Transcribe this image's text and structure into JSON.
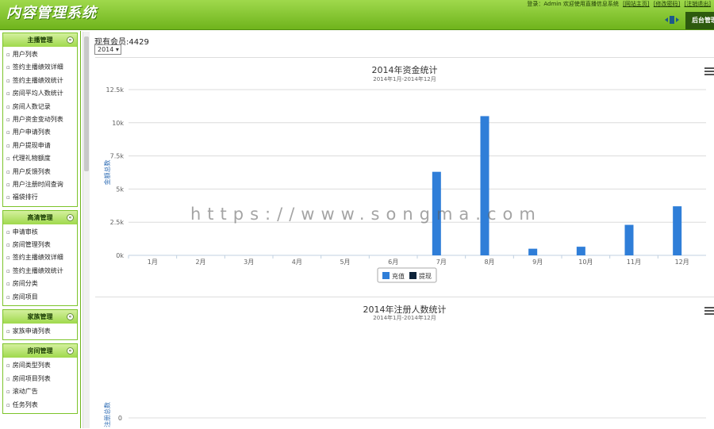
{
  "header": {
    "app_title": "内容管理系统",
    "login_text": "登录：Admin  欢迎使用直播信息系统",
    "links": [
      "[网站主页]",
      "[修改密码]",
      "[注销退出]"
    ],
    "backend_tab": "后台管理"
  },
  "sidebar": {
    "groups": [
      {
        "title": "主播管理",
        "items": [
          "用户列表",
          "签约主播绩效详细",
          "签约主播绩效统计",
          "房间平均人数统计",
          "房间人数记录",
          "用户资金变动列表",
          "用户申请列表",
          "用户提现申请",
          "代理礼物额度",
          "用户反馈列表",
          "用户注册时间查询",
          "福袋排行"
        ]
      },
      {
        "title": "高清管理",
        "items": [
          "申请审核",
          "房间管理列表",
          "签约主播绩效详细",
          "签约主播绩效统计",
          "房间分类",
          "房间项目"
        ]
      },
      {
        "title": "家族管理",
        "items": [
          "家族申请列表"
        ]
      },
      {
        "title": "房间管理",
        "items": [
          "房间类型列表",
          "房间项目列表",
          "滚动广告",
          "任务列表"
        ]
      }
    ]
  },
  "main": {
    "member_label": "现有会员:",
    "member_count": "4429",
    "year_select": "2014"
  },
  "watermark": "https://www.songma.com",
  "colors": {
    "header": "#8fcf3c",
    "bar_recharge": "#2f7ed8",
    "bar_withdraw": "#0d233a"
  },
  "chart_data": [
    {
      "type": "bar",
      "title": "2014年资金统计",
      "subtitle": "2014年1月-2014年12月",
      "ylabel": "金额总数",
      "categories": [
        "1月",
        "2月",
        "3月",
        "4月",
        "5月",
        "6月",
        "7月",
        "8月",
        "9月",
        "10月",
        "11月",
        "12月"
      ],
      "series": [
        {
          "name": "充值",
          "color": "#2f7ed8",
          "values": [
            0,
            0,
            0,
            0,
            0,
            0,
            6300,
            10500,
            500,
            650,
            2300,
            3700
          ]
        },
        {
          "name": "提现",
          "color": "#0d233a",
          "values": [
            0,
            0,
            0,
            0,
            0,
            0,
            0,
            0,
            0,
            0,
            0,
            0
          ]
        }
      ],
      "ylim": [
        0,
        12500
      ],
      "yticks": [
        "0k",
        "2.5k",
        "5k",
        "7.5k",
        "10k",
        "12.5k"
      ],
      "grid": true,
      "legend": "bottom-center"
    },
    {
      "type": "bar",
      "title": "2014年注册人数统计",
      "subtitle": "2014年1月-2014年12月",
      "ylabel": "注册总数",
      "yticks": [
        "0"
      ],
      "grid": true
    }
  ]
}
